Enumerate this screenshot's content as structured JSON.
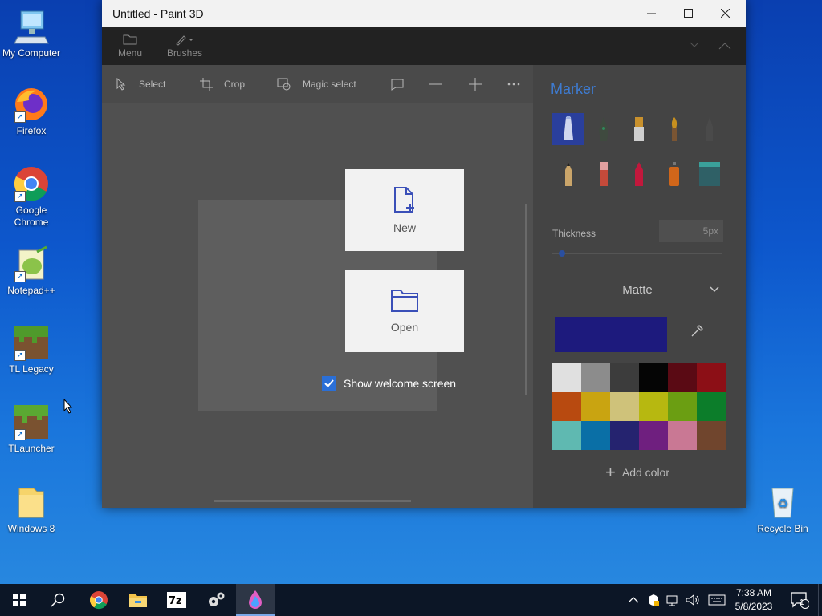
{
  "desktop": {
    "icons": [
      {
        "label": "My Computer"
      },
      {
        "label": "Firefox"
      },
      {
        "label": "Google Chrome"
      },
      {
        "label": "Notepad++"
      },
      {
        "label": "TL Legacy"
      },
      {
        "label": "TLauncher"
      },
      {
        "label": "Windows 8"
      },
      {
        "label": "Recycle Bin"
      }
    ]
  },
  "window": {
    "title": "Untitled - Paint 3D",
    "ribbon": {
      "menu_label": "Menu",
      "brushes_label": "Brushes"
    },
    "tools": {
      "select": "Select",
      "crop": "Crop",
      "magic_select": "Magic select"
    },
    "welcome": {
      "new_label": "New",
      "open_label": "Open",
      "show_welcome": "Show welcome screen"
    },
    "side_panel": {
      "header": "Marker",
      "thickness_label": "Thickness",
      "thickness_value": "5px",
      "finish": "Matte",
      "selected_color": "#1d1a7d",
      "add_color": "Add color",
      "palette": [
        "#e0e0e0",
        "#8c8c8c",
        "#3c3c3c",
        "#050505",
        "#5a0a14",
        "#8c0f16",
        "#b84a10",
        "#c9a411",
        "#cfc27a",
        "#b7b810",
        "#6b9e12",
        "#0c7d2a",
        "#5fb9b1",
        "#0a6fa6",
        "#25236f",
        "#6f1f7f",
        "#c97894",
        "#70452d"
      ]
    }
  },
  "taskbar": {
    "time": "7:38 AM",
    "date": "5/8/2023",
    "notification_count": "1"
  }
}
